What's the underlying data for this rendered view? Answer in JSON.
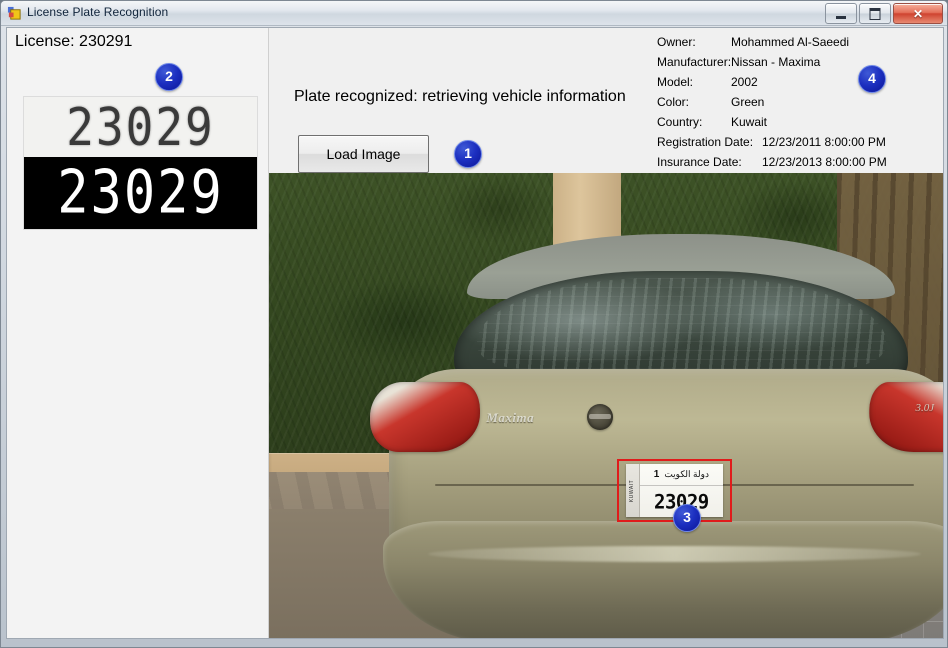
{
  "window": {
    "title": "License Plate Recognition",
    "icon": "app-icon",
    "buttons": {
      "minimize": "minimize",
      "maximize": "maximize",
      "close": "✕"
    }
  },
  "left_panel": {
    "license_label": "License: 230291",
    "plate_crop_light": "23029",
    "plate_crop_binary": "23029"
  },
  "center_panel": {
    "status": "Plate recognized: retrieving vehicle information",
    "load_button": "Load Image"
  },
  "info_panel": {
    "rows": [
      {
        "label": "Owner:",
        "value": "Mohammed Al-Saeedi"
      },
      {
        "label": "Manufacturer:",
        "value": "Nissan - Maxima"
      },
      {
        "label": "Model:",
        "value": "2002"
      },
      {
        "label": "Color:",
        "value": "Green"
      },
      {
        "label": "Country:",
        "value": "Kuwait"
      },
      {
        "label": "Registration Date:",
        "value": "12/23/2011 8:00:00 PM"
      },
      {
        "label": "Insurance Date:",
        "value": "12/23/2013 8:00:00 PM"
      }
    ]
  },
  "markers": {
    "m1": "1",
    "m2": "2",
    "m3": "3",
    "m4": "4"
  },
  "photo": {
    "car_plate": {
      "country_side": "KUWAIT",
      "arabic": "دولة الكويت",
      "serial": "1",
      "number": "23029"
    },
    "badges": {
      "model_script": "Maxima",
      "trim": "3.0J"
    }
  },
  "colors": {
    "marker_blue": "#1c2fc0",
    "detection_box_red": "#e01b1b",
    "titlebar_close": "#cf4430"
  }
}
